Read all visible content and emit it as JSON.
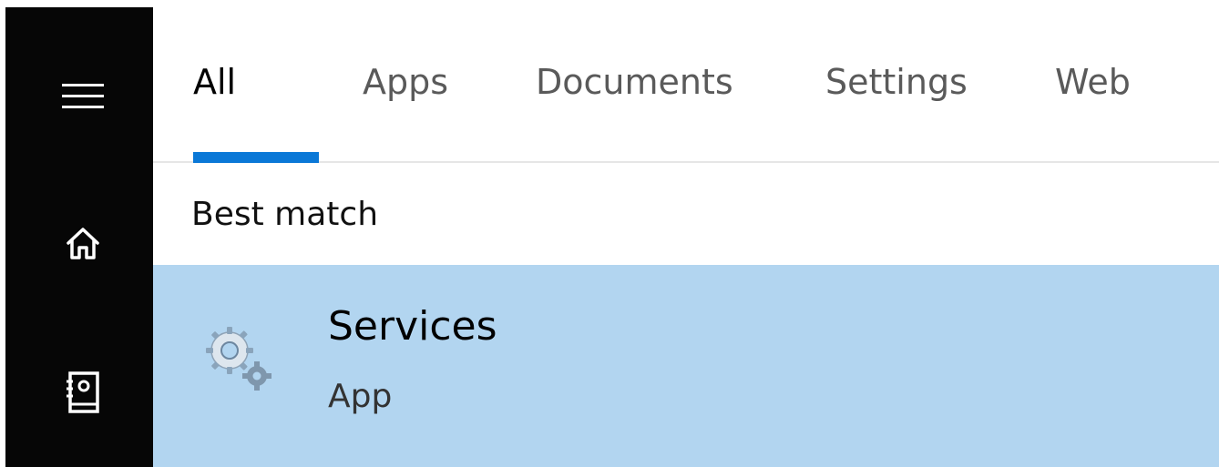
{
  "rail": {
    "items": [
      {
        "icon": "hamburger-menu-icon"
      },
      {
        "icon": "home-icon"
      },
      {
        "icon": "notebook-icon"
      }
    ]
  },
  "tabs": [
    {
      "label": "All",
      "active": true
    },
    {
      "label": "Apps",
      "active": false
    },
    {
      "label": "Documents",
      "active": false
    },
    {
      "label": "Settings",
      "active": false
    },
    {
      "label": "Web",
      "active": false
    }
  ],
  "section": {
    "label": "Best match"
  },
  "result": {
    "title": "Services",
    "subtitle": "App",
    "icon": "services-gears-icon"
  },
  "colors": {
    "rail_background": "#060606",
    "accent": "#0a78d7",
    "selected_background": "#b2d5f0"
  }
}
